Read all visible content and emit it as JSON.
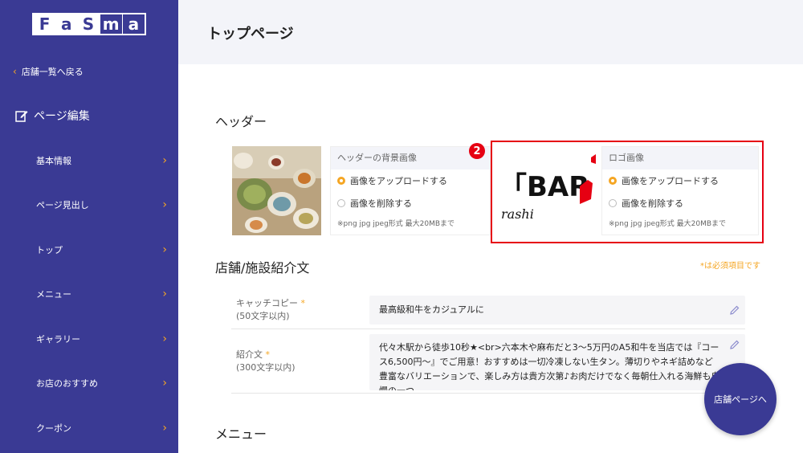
{
  "logo": {
    "letters": [
      "F",
      "a",
      "S",
      "m",
      "a"
    ]
  },
  "sidebar": {
    "back_label": "店舗一覧へ戻る",
    "section_label": "ページ編集",
    "items": [
      {
        "label": "基本情報"
      },
      {
        "label": "ページ見出し"
      },
      {
        "label": "トップ"
      },
      {
        "label": "メニュー"
      },
      {
        "label": "ギャラリー"
      },
      {
        "label": "お店のおすすめ"
      },
      {
        "label": "クーポン"
      }
    ]
  },
  "header": {
    "title": "トップページ"
  },
  "sections": {
    "header_section": "ヘッダー",
    "store_section": "店舗/施設紹介文",
    "menu_section": "メニュー"
  },
  "bg_panel": {
    "title": "ヘッダーの背景画像",
    "upload_label": "画像をアップロードする",
    "delete_label": "画像を削除する",
    "note": "※png jpg jpeg形式 最大20MBまで"
  },
  "logo_panel": {
    "title": "ロゴ画像",
    "upload_label": "画像をアップロードする",
    "delete_label": "画像を削除する",
    "note": "※png jpg jpeg形式 最大20MBまで",
    "logo_text": "「BAR",
    "logo_sub": "rashi"
  },
  "badge": "2",
  "required_note": "*は必須項目です",
  "fields": [
    {
      "label": "キャッチコピー",
      "star": "*",
      "limit": "(50文字以内)",
      "value": "最高級和牛をカジュアルに"
    },
    {
      "label": "紹介文",
      "star": "*",
      "limit": "(300文字以内)",
      "value": "代々木駅から徒歩10秒★<br>六本木や麻布だと3〜5万円のA5和牛を当店では『コース6,500円〜』でご用意！おすすめは一切冷凍しない生タン。薄切りやネギ詰めなど豊富なバリエーションで、楽しみ方は貴方次第♪お肉だけでなく毎朝仕入れる海鮮も自慢の一つ。"
    }
  ],
  "fab_label": "店舗ページへ",
  "colors": {
    "sidebar": "#3a3a94",
    "accent": "#f5a623",
    "highlight": "#e60012"
  }
}
